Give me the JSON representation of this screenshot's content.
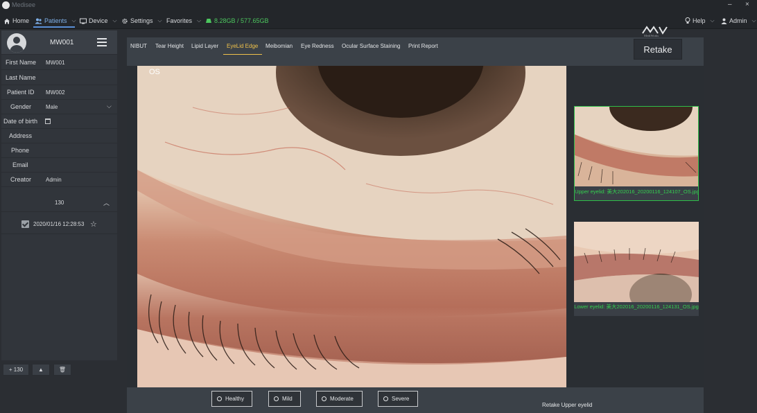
{
  "window": {
    "title": "Medisee",
    "minimize": "–",
    "close": "×"
  },
  "nav": {
    "home": "Home",
    "patients": "Patients",
    "device": "Device",
    "settings": "Settings",
    "favorites": "Favorites",
    "storage": "8.28GB / 577.65GB",
    "brand": "MediWorks",
    "help": "Help",
    "admin": "Admin"
  },
  "patient": {
    "header_id": "MW001",
    "fields": {
      "first_name_label": "First Name",
      "first_name": "MW001",
      "last_name_label": "Last Name",
      "last_name": "",
      "patient_id_label": "Patient ID",
      "patient_id": "MW002",
      "gender_label": "Gender",
      "gender": "Male",
      "dob_label": "Date of birth",
      "address_label": "Address",
      "phone_label": "Phone",
      "email_label": "Email",
      "creator_label": "Creator",
      "creator": "Admin"
    }
  },
  "records": {
    "count": "130",
    "items": [
      {
        "date": "2020/01/16 12:28:53",
        "checked": true
      }
    ]
  },
  "footer": {
    "add_label": "+ 130",
    "up_label": "▲",
    "delete_label": "🗑"
  },
  "tabs": [
    "NIBUT",
    "Tear Height",
    "Lipid Layer",
    "EyeLid Edge",
    "Meibomian",
    "Eye Redness",
    "Ocular Surface Staining",
    "Print Report"
  ],
  "active_tab": "EyeLid Edge",
  "retake_label": "Retake",
  "image": {
    "eye_label": "OS"
  },
  "thumbnails": [
    {
      "caption": "Upper eyelid: 美大202016_20200116_124107_OS.jpg",
      "selected": true
    },
    {
      "caption": "Lower eyelid: 美大202016_20200116_124131_OS.jpg",
      "selected": false
    }
  ],
  "grades": [
    "Healthy",
    "Mild",
    "Moderate",
    "Severe"
  ],
  "status": "Retake Upper eyelid",
  "colors": {
    "accent": "#5a8fd6",
    "active_tab": "#f0c24b",
    "selected_thumb": "#2fbf4a",
    "storage": "#4cc65e"
  }
}
